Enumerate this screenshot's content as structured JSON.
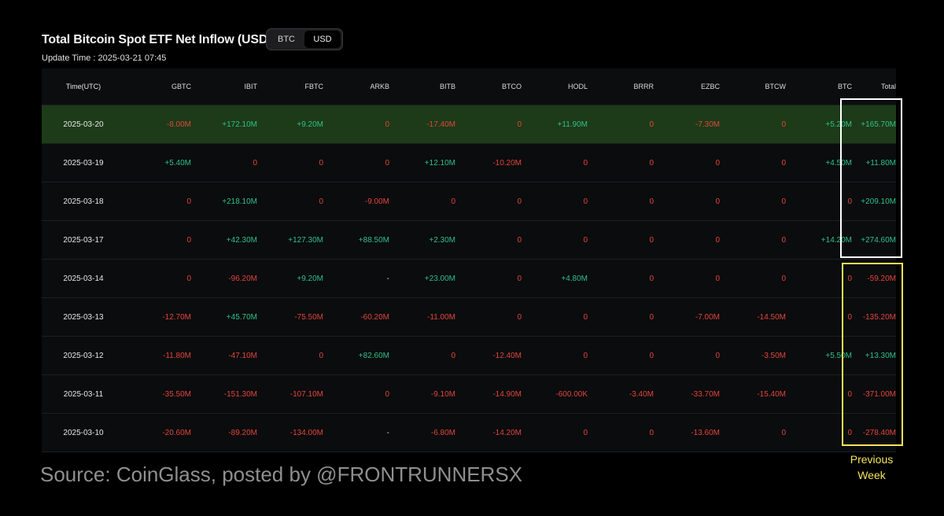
{
  "header": {
    "title": "Total Bitcoin Spot ETF Net Inflow (USD)",
    "toggle": [
      "BTC",
      "USD"
    ],
    "toggle_selected": "USD",
    "update_time": "Update Time : 2025-03-21 07:45"
  },
  "table": {
    "columns": [
      "Time(UTC)",
      "GBTC",
      "IBIT",
      "FBTC",
      "ARKB",
      "BITB",
      "BTCO",
      "HODL",
      "BRRR",
      "EZBC",
      "BTCW",
      "BTC",
      "Total"
    ],
    "rows": [
      {
        "date": "2025-03-20",
        "highlight": true,
        "cells": [
          "-8.00M",
          "+172.10M",
          "+9.20M",
          "0",
          "-17.40M",
          "0",
          "+11.90M",
          "0",
          "-7.30M",
          "0",
          "+5.20M",
          "+165.70M"
        ]
      },
      {
        "date": "2025-03-19",
        "highlight": false,
        "cells": [
          "+5.40M",
          "0",
          "0",
          "0",
          "+12.10M",
          "-10.20M",
          "0",
          "0",
          "0",
          "0",
          "+4.50M",
          "+11.80M"
        ]
      },
      {
        "date": "2025-03-18",
        "highlight": false,
        "cells": [
          "0",
          "+218.10M",
          "0",
          "-9.00M",
          "0",
          "0",
          "0",
          "0",
          "0",
          "0",
          "0",
          "+209.10M"
        ]
      },
      {
        "date": "2025-03-17",
        "highlight": false,
        "cells": [
          "0",
          "+42.30M",
          "+127.30M",
          "+88.50M",
          "+2.30M",
          "0",
          "0",
          "0",
          "0",
          "0",
          "+14.20M",
          "+274.60M"
        ]
      },
      {
        "date": "2025-03-14",
        "highlight": false,
        "cells": [
          "0",
          "-96.20M",
          "+9.20M",
          "-",
          "+23.00M",
          "0",
          "+4.80M",
          "0",
          "0",
          "0",
          "0",
          "-59.20M"
        ]
      },
      {
        "date": "2025-03-13",
        "highlight": false,
        "cells": [
          "-12.70M",
          "+45.70M",
          "-75.50M",
          "-60.20M",
          "-11.00M",
          "0",
          "0",
          "0",
          "-7.00M",
          "-14.50M",
          "0",
          "-135.20M"
        ]
      },
      {
        "date": "2025-03-12",
        "highlight": false,
        "cells": [
          "-11.80M",
          "-47.10M",
          "0",
          "+82.60M",
          "0",
          "-12.40M",
          "0",
          "0",
          "0",
          "-3.50M",
          "+5.50M",
          "+13.30M"
        ]
      },
      {
        "date": "2025-03-11",
        "highlight": false,
        "cells": [
          "-35.50M",
          "-151.30M",
          "-107.10M",
          "0",
          "-9.10M",
          "-14.90M",
          "-600.00K",
          "-3.40M",
          "-33.70M",
          "-15.40M",
          "0",
          "-371.00M"
        ]
      },
      {
        "date": "2025-03-10",
        "highlight": false,
        "cells": [
          "-20.60M",
          "-89.20M",
          "-134.00M",
          "-",
          "-6.80M",
          "-14.20M",
          "0",
          "0",
          "-13.60M",
          "0",
          "0",
          "-278.40M"
        ]
      }
    ]
  },
  "annotations": {
    "previous_week_line1": "Previous",
    "previous_week_line2": "Week",
    "source": "Source: CoinGlass, posted by @FRONTRUNNERSX"
  },
  "colors": {
    "positive": "#2fbf8a",
    "negative": "#e0443e",
    "highlight_row": "#1d3b18",
    "white_box": "#ffffff",
    "yellow_box": "#f4e35b"
  }
}
